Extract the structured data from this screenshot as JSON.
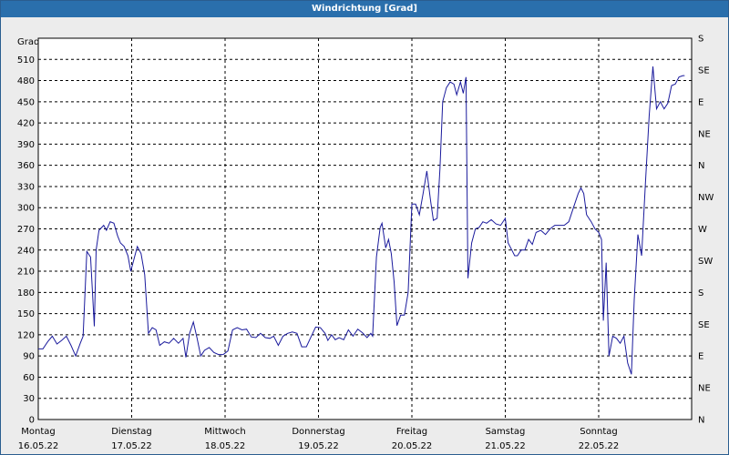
{
  "window": {
    "title": "Windrichtung [Grad]"
  },
  "colors": {
    "title_bar": "#2a6fac",
    "line": "#1a1a9c",
    "plot_bg": "#ffffff",
    "grid": "#000000"
  },
  "chart_data": {
    "type": "line",
    "title": "Windrichtung [Grad]",
    "ylabel": "Grad",
    "ylim": [
      0,
      540
    ],
    "y_ticks": [
      0,
      30,
      60,
      90,
      120,
      150,
      180,
      210,
      240,
      270,
      300,
      330,
      360,
      390,
      420,
      450,
      480,
      510
    ],
    "right_axis_labels": [
      {
        "value": 0,
        "label": "N"
      },
      {
        "value": 45,
        "label": "NE"
      },
      {
        "value": 90,
        "label": "E"
      },
      {
        "value": 135,
        "label": "SE"
      },
      {
        "value": 180,
        "label": "S"
      },
      {
        "value": 225,
        "label": "SW"
      },
      {
        "value": 270,
        "label": "W"
      },
      {
        "value": 315,
        "label": "NW"
      },
      {
        "value": 360,
        "label": "N"
      },
      {
        "value": 405,
        "label": "NE"
      },
      {
        "value": 450,
        "label": "E"
      },
      {
        "value": 495,
        "label": "SE"
      },
      {
        "value": 540,
        "label": "S"
      }
    ],
    "x_ticks": [
      {
        "day": 0,
        "weekday": "Montag",
        "date": "16.05.22"
      },
      {
        "day": 1,
        "weekday": "Dienstag",
        "date": "17.05.22"
      },
      {
        "day": 2,
        "weekday": "Mittwoch",
        "date": "18.05.22"
      },
      {
        "day": 3,
        "weekday": "Donnerstag",
        "date": "19.05.22"
      },
      {
        "day": 4,
        "weekday": "Freitag",
        "date": "20.05.22"
      },
      {
        "day": 5,
        "weekday": "Samstag",
        "date": "21.05.22"
      },
      {
        "day": 6,
        "weekday": "Sonntag",
        "date": "22.05.22"
      }
    ],
    "x_range": [
      0,
      6.95
    ],
    "grid": true,
    "series": [
      {
        "points": [
          [
            0.0,
            100
          ],
          [
            0.05,
            100
          ],
          [
            0.1,
            110
          ],
          [
            0.15,
            118
          ],
          [
            0.2,
            107
          ],
          [
            0.25,
            112
          ],
          [
            0.3,
            118
          ],
          [
            0.35,
            105
          ],
          [
            0.4,
            90
          ],
          [
            0.45,
            108
          ],
          [
            0.48,
            118
          ],
          [
            0.52,
            238
          ],
          [
            0.56,
            230
          ],
          [
            0.6,
            132
          ],
          [
            0.62,
            240
          ],
          [
            0.65,
            268
          ],
          [
            0.7,
            275
          ],
          [
            0.73,
            268
          ],
          [
            0.77,
            280
          ],
          [
            0.81,
            278
          ],
          [
            0.85,
            260
          ],
          [
            0.88,
            250
          ],
          [
            0.92,
            245
          ],
          [
            0.96,
            232
          ],
          [
            0.99,
            210
          ],
          [
            1.02,
            225
          ],
          [
            1.06,
            245
          ],
          [
            1.1,
            235
          ],
          [
            1.14,
            205
          ],
          [
            1.18,
            122
          ],
          [
            1.22,
            130
          ],
          [
            1.26,
            127
          ],
          [
            1.3,
            105
          ],
          [
            1.35,
            110
          ],
          [
            1.4,
            108
          ],
          [
            1.45,
            115
          ],
          [
            1.5,
            108
          ],
          [
            1.55,
            115
          ],
          [
            1.58,
            88
          ],
          [
            1.62,
            122
          ],
          [
            1.66,
            138
          ],
          [
            1.7,
            115
          ],
          [
            1.74,
            90
          ],
          [
            1.78,
            98
          ],
          [
            1.83,
            102
          ],
          [
            1.88,
            95
          ],
          [
            1.93,
            92
          ],
          [
            1.98,
            92
          ],
          [
            2.03,
            97
          ],
          [
            2.08,
            127
          ],
          [
            2.13,
            130
          ],
          [
            2.18,
            127
          ],
          [
            2.23,
            128
          ],
          [
            2.28,
            117
          ],
          [
            2.33,
            116
          ],
          [
            2.38,
            122
          ],
          [
            2.43,
            116
          ],
          [
            2.48,
            115
          ],
          [
            2.52,
            118
          ],
          [
            2.57,
            105
          ],
          [
            2.62,
            118
          ],
          [
            2.67,
            122
          ],
          [
            2.72,
            124
          ],
          [
            2.77,
            122
          ],
          [
            2.82,
            103
          ],
          [
            2.87,
            103
          ],
          [
            2.92,
            117
          ],
          [
            2.97,
            131
          ],
          [
            3.02,
            130
          ],
          [
            3.07,
            122
          ],
          [
            3.1,
            112
          ],
          [
            3.14,
            120
          ],
          [
            3.18,
            113
          ],
          [
            3.22,
            116
          ],
          [
            3.27,
            113
          ],
          [
            3.32,
            127
          ],
          [
            3.37,
            118
          ],
          [
            3.42,
            128
          ],
          [
            3.47,
            123
          ],
          [
            3.52,
            116
          ],
          [
            3.56,
            122
          ],
          [
            3.58,
            118
          ],
          [
            3.62,
            230
          ],
          [
            3.66,
            272
          ],
          [
            3.68,
            278
          ],
          [
            3.72,
            243
          ],
          [
            3.75,
            255
          ],
          [
            3.78,
            235
          ],
          [
            3.81,
            195
          ],
          [
            3.84,
            133
          ],
          [
            3.88,
            148
          ],
          [
            3.92,
            148
          ],
          [
            3.96,
            180
          ],
          [
            4.0,
            305
          ],
          [
            4.04,
            305
          ],
          [
            4.08,
            290
          ],
          [
            4.12,
            320
          ],
          [
            4.16,
            352
          ],
          [
            4.2,
            310
          ],
          [
            4.23,
            282
          ],
          [
            4.27,
            285
          ],
          [
            4.3,
            355
          ],
          [
            4.33,
            450
          ],
          [
            4.37,
            470
          ],
          [
            4.41,
            478
          ],
          [
            4.45,
            475
          ],
          [
            4.48,
            460
          ],
          [
            4.52,
            478
          ],
          [
            4.55,
            462
          ],
          [
            4.58,
            485
          ],
          [
            4.6,
            200
          ],
          [
            4.64,
            250
          ],
          [
            4.68,
            270
          ],
          [
            4.72,
            272
          ],
          [
            4.76,
            280
          ],
          [
            4.8,
            278
          ],
          [
            4.85,
            283
          ],
          [
            4.9,
            277
          ],
          [
            4.95,
            275
          ],
          [
            5.0,
            285
          ],
          [
            5.03,
            250
          ],
          [
            5.07,
            240
          ],
          [
            5.1,
            232
          ],
          [
            5.13,
            232
          ],
          [
            5.17,
            240
          ],
          [
            5.21,
            240
          ],
          [
            5.25,
            255
          ],
          [
            5.29,
            248
          ],
          [
            5.33,
            265
          ],
          [
            5.38,
            268
          ],
          [
            5.43,
            262
          ],
          [
            5.48,
            270
          ],
          [
            5.53,
            275
          ],
          [
            5.58,
            275
          ],
          [
            5.63,
            275
          ],
          [
            5.68,
            280
          ],
          [
            5.73,
            300
          ],
          [
            5.78,
            320
          ],
          [
            5.81,
            328
          ],
          [
            5.84,
            320
          ],
          [
            5.87,
            290
          ],
          [
            5.92,
            280
          ],
          [
            5.96,
            270
          ],
          [
            6.0,
            265
          ],
          [
            6.03,
            255
          ],
          [
            6.05,
            140
          ],
          [
            6.08,
            222
          ],
          [
            6.11,
            90
          ],
          [
            6.15,
            118
          ],
          [
            6.19,
            115
          ],
          [
            6.23,
            108
          ],
          [
            6.27,
            118
          ],
          [
            6.31,
            80
          ],
          [
            6.35,
            64
          ],
          [
            6.38,
            170
          ],
          [
            6.42,
            262
          ],
          [
            6.46,
            232
          ],
          [
            6.5,
            335
          ],
          [
            6.54,
            430
          ],
          [
            6.58,
            500
          ],
          [
            6.62,
            440
          ],
          [
            6.66,
            450
          ],
          [
            6.7,
            440
          ],
          [
            6.74,
            448
          ],
          [
            6.78,
            473
          ],
          [
            6.82,
            475
          ],
          [
            6.86,
            485
          ],
          [
            6.9,
            487
          ],
          [
            6.92,
            487
          ]
        ]
      }
    ]
  }
}
